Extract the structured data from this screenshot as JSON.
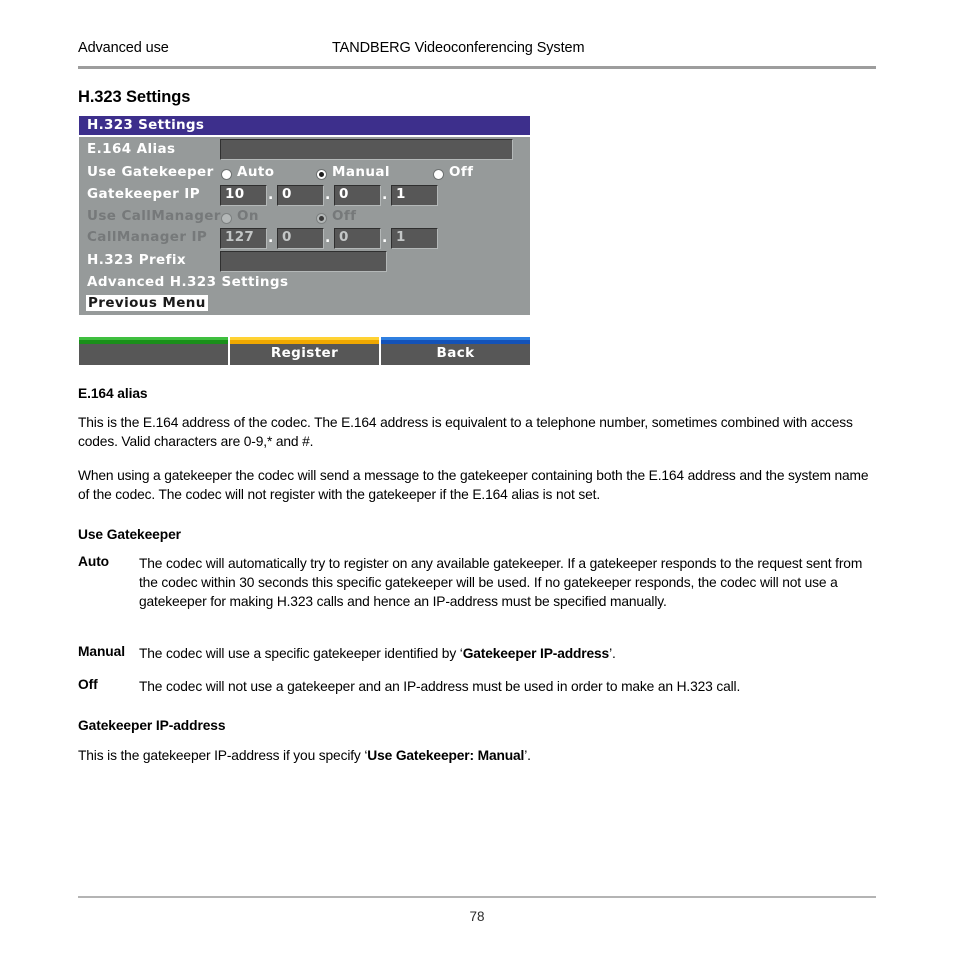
{
  "header": {
    "left": "Advanced use",
    "center": "TANDBERG Videoconferencing System"
  },
  "section_title": "H.323 Settings",
  "device_ui": {
    "titlebar": "H.323 Settings",
    "rows": {
      "e164_alias": {
        "label": "E.164 Alias",
        "value": ""
      },
      "use_gatekeeper": {
        "label": "Use Gatekeeper",
        "options": [
          "Auto",
          "Manual",
          "Off"
        ],
        "selected": "Manual"
      },
      "gatekeeper_ip": {
        "label": "Gatekeeper IP",
        "octets": [
          "10",
          "0",
          "0",
          "1"
        ],
        "separator": "."
      },
      "use_callmanager": {
        "label": "Use CallManager",
        "options": [
          "On",
          "Off"
        ],
        "selected": "Off",
        "disabled": true
      },
      "callmanager_ip": {
        "label": "CallManager IP",
        "octets": [
          "127",
          "0",
          "0",
          "1"
        ],
        "separator": ".",
        "disabled": true
      },
      "h323_prefix": {
        "label": "H.323 Prefix",
        "value": ""
      },
      "advanced": {
        "label": "Advanced H.323 Settings"
      },
      "previous_menu": {
        "label": "Previous Menu",
        "highlighted": true
      }
    },
    "softkeys": [
      {
        "label": "",
        "color": "#1a8f1a",
        "highlight": "#3fbf3f"
      },
      {
        "label": "Register",
        "color": "#f0a800",
        "highlight": "#ffd233"
      },
      {
        "label": "Back",
        "color": "#1352b8",
        "highlight": "#2f7fe0"
      }
    ]
  },
  "content": {
    "e164_heading": "E.164 alias",
    "e164_para1": "This is the E.164 address of the codec. The E.164 address is equivalent to a telephone number, sometimes combined with access codes. Valid characters are 0-9,* and #.",
    "e164_para2": "When using a gatekeeper the codec will send a message to the gatekeeper containing both the E.164 address and the system name of the codec. The codec will not register with the gatekeeper if the E.164 alias is not set.",
    "use_gatekeeper_heading": "Use Gatekeeper",
    "terms": [
      {
        "term": "Auto",
        "body": "The codec will automatically try to register on any available gatekeeper. If a gatekeeper responds to the request sent from the codec within 30 seconds this specific gatekeeper will be used. If no gatekeeper responds, the codec will not use a gatekeeper for making H.323 calls and hence an IP-address must be specified manually."
      },
      {
        "term": "Manual",
        "body_pre": "The codec will use a specific gatekeeper identified by ‘",
        "body_bold": "Gatekeeper IP-address",
        "body_post": "’."
      },
      {
        "term": "Off",
        "body": "The codec will not use a gatekeeper and an IP-address must be used in order to make an H.323 call."
      }
    ],
    "gk_ip_heading": "Gatekeeper IP-address",
    "gk_ip_pre": "This is the gatekeeper IP-address if you specify ‘",
    "gk_ip_bold": "Use Gatekeeper: Manual",
    "gk_ip_post": "’."
  },
  "footer": {
    "page_number": "78"
  }
}
